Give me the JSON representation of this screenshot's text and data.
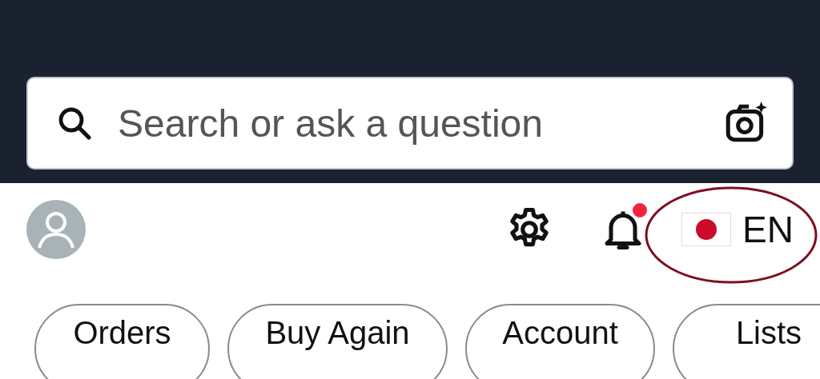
{
  "search": {
    "placeholder": "Search or ask a question"
  },
  "notifications": {
    "unread": true
  },
  "language": {
    "code": "EN"
  },
  "chips": [
    {
      "label": "Orders"
    },
    {
      "label": "Buy Again"
    },
    {
      "label": "Account"
    },
    {
      "label": "Lists"
    }
  ]
}
